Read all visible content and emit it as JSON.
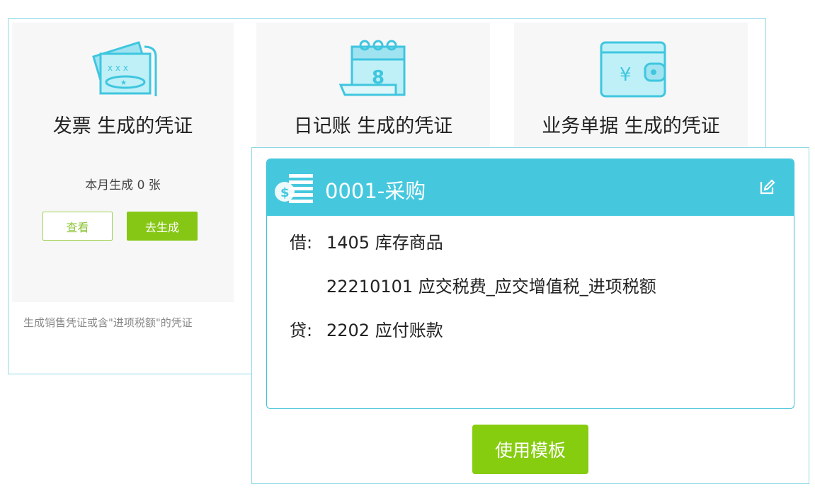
{
  "cards": [
    {
      "title": "发票 生成的凭证",
      "icon": "invoice-icon"
    },
    {
      "title": "日记账 生成的凭证",
      "icon": "calendar-journal-icon"
    },
    {
      "title": "业务单据 生成的凭证",
      "icon": "wallet-icon"
    }
  ],
  "invoice_card": {
    "stat": "本月生成 0 张",
    "view_label": "查看",
    "generate_label": "去生成",
    "footnote": "生成销售凭证或含\"进项税额\"的凭证"
  },
  "template": {
    "title": "0001-采购",
    "entries": [
      {
        "tag": "借:",
        "text": "1405 库存商品"
      },
      {
        "tag": "",
        "text": "22210101 应交税费_应交增值税_进项税额"
      },
      {
        "tag": "贷:",
        "text": "2202 应付账款"
      }
    ],
    "use_label": "使用模板"
  },
  "colors": {
    "accent_blue": "#45c8de",
    "accent_green": "#86c715",
    "border": "#8fd8e6"
  }
}
